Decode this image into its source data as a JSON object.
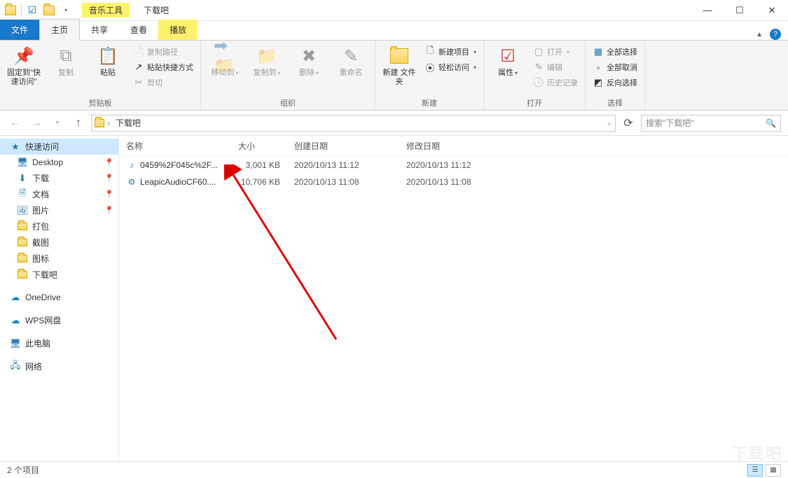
{
  "title": "下载吧",
  "contextTab": "音乐工具",
  "tabs": {
    "file": "文件",
    "home": "主页",
    "share": "共享",
    "view": "查看",
    "play": "播放"
  },
  "ribbon": {
    "pin": "固定到\"快\n速访问\"",
    "copy": "复制",
    "paste": "粘贴",
    "copyPath": "复制路径",
    "pasteShortcut": "粘贴快捷方式",
    "cut": "剪切",
    "clipboard": "剪贴板",
    "moveTo": "移动到",
    "copyTo": "复制到",
    "delete": "删除",
    "rename": "重命名",
    "organize": "组织",
    "newFolder": "新建\n文件夹",
    "newItem": "新建项目",
    "easyAccess": "轻松访问",
    "new": "新建",
    "properties": "属性",
    "open": "打开",
    "edit": "编辑",
    "history": "历史记录",
    "openGroup": "打开",
    "selectAll": "全部选择",
    "selectNone": "全部取消",
    "invert": "反向选择",
    "select": "选择"
  },
  "breadcrumb": {
    "root": "下载吧"
  },
  "search": {
    "placeholder": "搜索\"下载吧\""
  },
  "sidebar": {
    "quickAccess": "快速访问",
    "items": [
      {
        "label": "Desktop",
        "pin": true
      },
      {
        "label": "下载",
        "pin": true
      },
      {
        "label": "文档",
        "pin": true
      },
      {
        "label": "图片",
        "pin": true
      },
      {
        "label": "打包",
        "pin": false
      },
      {
        "label": "截图",
        "pin": false
      },
      {
        "label": "图标",
        "pin": false
      },
      {
        "label": "下载吧",
        "pin": false
      }
    ],
    "onedrive": "OneDrive",
    "wps": "WPS网盘",
    "thisPc": "此电脑",
    "network": "网络"
  },
  "columns": {
    "name": "名称",
    "size": "大小",
    "created": "创建日期",
    "modified": "修改日期"
  },
  "files": [
    {
      "name": "0459%2F045c%2F...",
      "size": "3,001 KB",
      "created": "2020/10/13 11:12",
      "modified": "2020/10/13 11:12",
      "type": "audio"
    },
    {
      "name": "LeapicAudioCF60....",
      "size": "10,706 KB",
      "created": "2020/10/13 11:08",
      "modified": "2020/10/13 11:08",
      "type": "exe"
    }
  ],
  "status": "2 个项目",
  "watermark": "下载吧"
}
